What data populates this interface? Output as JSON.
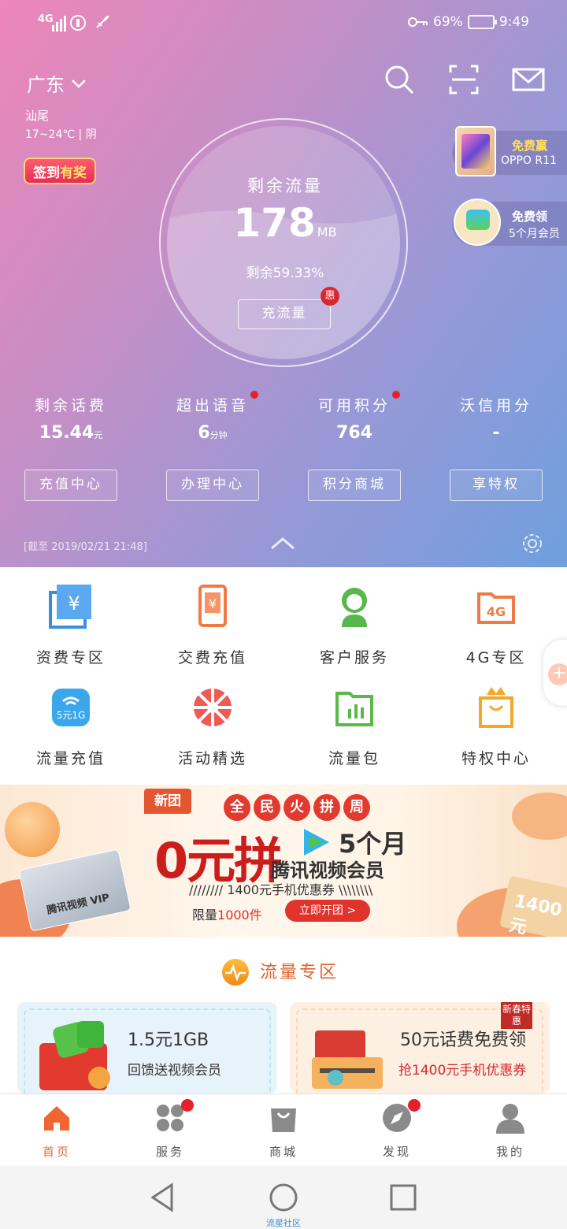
{
  "status_bar": {
    "network": "4G",
    "battery": "69%",
    "time": "9:49"
  },
  "header": {
    "province": "广东",
    "city": "汕尾",
    "weather": "17~24℃ | 阴",
    "signin_prefix": "签到",
    "signin_suffix": "有奖"
  },
  "usage": {
    "label": "剩余流量",
    "value": "178",
    "unit": "MB",
    "percent_text": "剩余59.33%",
    "recharge_button": "充流量",
    "badge": "惠"
  },
  "promos": [
    {
      "line1": "免费赢",
      "line2": "OPPO R11"
    },
    {
      "line1": "免费领",
      "line2": "5个月会员"
    }
  ],
  "stats": [
    {
      "label": "剩余话费",
      "value": "15.44",
      "unit": "元"
    },
    {
      "label": "超出语音",
      "value": "6",
      "unit": "分钟"
    },
    {
      "label": "可用积分",
      "value": "764",
      "unit": ""
    },
    {
      "label": "沃信用分",
      "value": "-",
      "unit": ""
    }
  ],
  "actions": [
    "充值中心",
    "办理中心",
    "积分商城",
    "享特权"
  ],
  "deadline": "[截至 2019/02/21 21:48]",
  "services": [
    {
      "label": "资费专区",
      "icon": "tariff-icon"
    },
    {
      "label": "交费充值",
      "icon": "phone-pay-icon"
    },
    {
      "label": "客户服务",
      "icon": "customer-service-icon"
    },
    {
      "label": "4G专区",
      "icon": "4g-folder-icon",
      "icon_text": "4G"
    },
    {
      "label": "流量充值",
      "icon": "wifi-5yuan-icon",
      "icon_text": "5元1G"
    },
    {
      "label": "活动精选",
      "icon": "wheel-icon"
    },
    {
      "label": "流量包",
      "icon": "data-package-icon"
    },
    {
      "label": "特权中心",
      "icon": "crown-bag-icon"
    }
  ],
  "banner": {
    "tag": "新团",
    "headline": [
      "全",
      "民",
      "火",
      "拼",
      "周"
    ],
    "big": "0元拼",
    "months": "5个月",
    "member": "腾讯视频会员",
    "coupon": "////////  1400元手机优惠券  \\\\\\\\\\\\\\\\",
    "limit_prefix": "限量",
    "limit_value": "1000件",
    "button": "立即开团 >",
    "card_text": "腾讯视频 VIP",
    "right_coupon": "1400元"
  },
  "section": {
    "title": "流量专区",
    "cards": [
      {
        "title": "1.5元1GB",
        "subtitle": "回馈送视频会员"
      },
      {
        "title": "50元话费免费领",
        "subtitle": "抢1400元手机优惠券",
        "tag": "新春特惠"
      }
    ]
  },
  "tabbar": [
    {
      "label": "首页",
      "icon": "home-icon",
      "active": true
    },
    {
      "label": "服务",
      "icon": "grid-icon",
      "dot": true
    },
    {
      "label": "商城",
      "icon": "shopping-bag-icon"
    },
    {
      "label": "发现",
      "icon": "compass-icon",
      "dot": true
    },
    {
      "label": "我的",
      "icon": "user-icon"
    }
  ],
  "nav_label": "流星社区",
  "colors": {
    "accent": "#f06632",
    "hero_start": "#ee86b9",
    "hero_end": "#6f9fde",
    "badge_red": "#d9262f"
  }
}
